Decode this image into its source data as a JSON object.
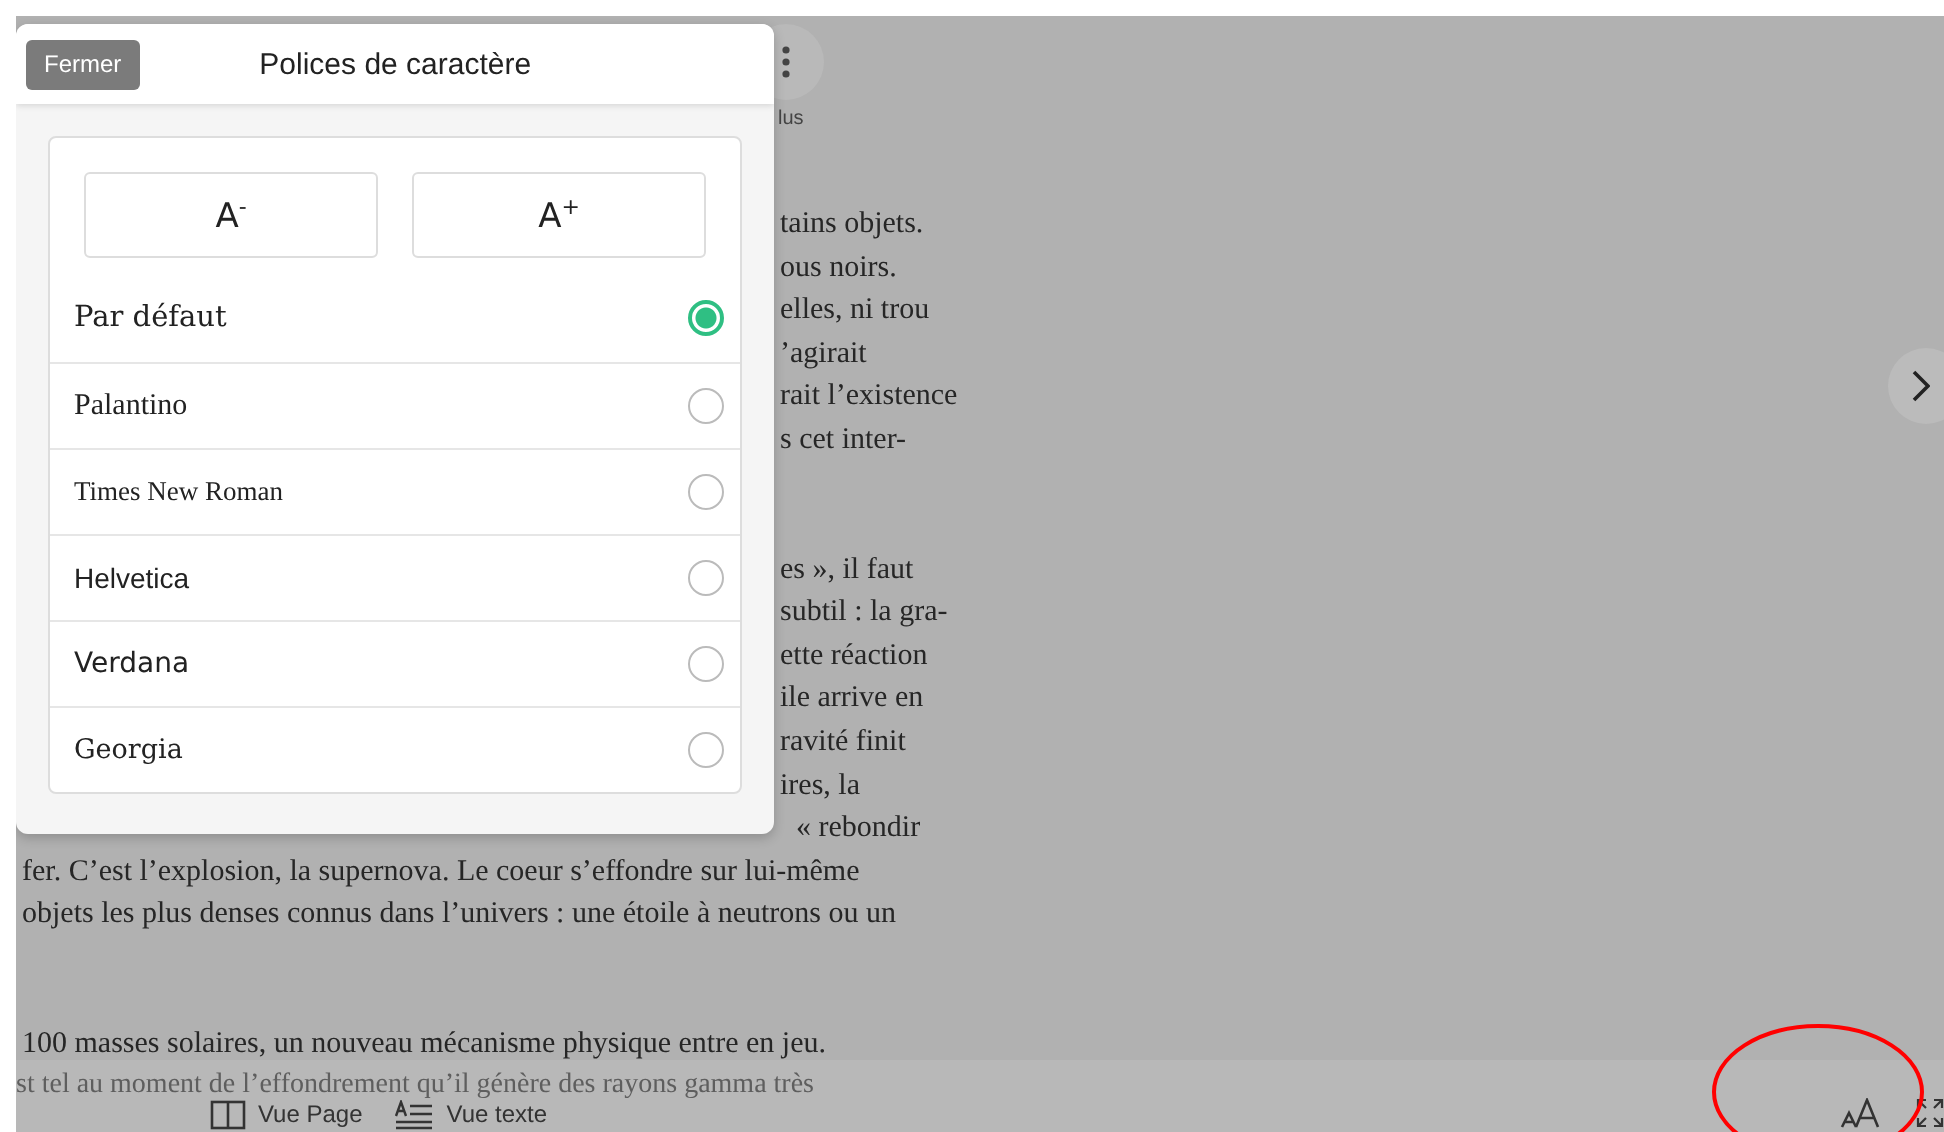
{
  "top_bar": {
    "more_label": "lus"
  },
  "modal": {
    "close": "Fermer",
    "title": "Polices de caractère",
    "size_buttons": [
      "A$^{-}$",
      "A$^{+}$"
    ],
    "fonts": [
      {
        "label": "Par défaut",
        "kind": "default",
        "selected": true
      },
      {
        "label": "Palantino",
        "kind": "palatino",
        "selected": false
      },
      {
        "label": "Times New Roman",
        "kind": "times",
        "selected": false
      },
      {
        "label": "Helvetica",
        "kind": "helvetica",
        "selected": false
      },
      {
        "label": "Verdana",
        "kind": "verdana",
        "selected": false
      },
      {
        "label": "Georgia",
        "kind": "georgia",
        "selected": false
      }
    ]
  },
  "reader": {
    "paragraphs": [
      {
        "lines": [
          {
            "text": "tains objets.",
            "kind": "clipped"
          },
          {
            "text": "ous noirs.",
            "kind": "clipped"
          },
          {
            "text": "elles, ni trou",
            "kind": "clipped"
          },
          {
            "text": "’agirait",
            "kind": "clipped"
          },
          {
            "text": "rait l’existence",
            "kind": "clipped"
          },
          {
            "text": "s cet inter-",
            "kind": "clipped"
          }
        ]
      },
      {
        "lines": [
          {
            "text": "es », il faut",
            "kind": "clipped"
          },
          {
            "text": "subtil : la gra-",
            "kind": "clipped"
          },
          {
            "text": "ette réaction",
            "kind": "clipped"
          },
          {
            "text": "ile arrive en",
            "kind": "clipped"
          },
          {
            "text": "ravité finit",
            "kind": "clipped"
          },
          {
            "text": "ires, la",
            "kind": "clipped"
          },
          {
            "text": "« rebondir",
            "kind": "tail"
          },
          {
            "text": "fer. C’est l’explosion, la supernova. Le coeur s’effondre sur lui-même",
            "kind": "full"
          },
          {
            "text": "objets les plus denses connus dans l’univers : une étoile à neutrons ou un",
            "kind": "full"
          }
        ]
      },
      {
        "lines": [
          {
            "text": "100 masses solaires, un nouveau mécanisme physique entre en jeu.",
            "kind": "full"
          },
          {
            "text": "st tel au moment de l’effondrement qu’il génère des rayons gamma très",
            "kind": "faded"
          }
        ]
      }
    ]
  },
  "bottom_bar": {
    "views": [
      {
        "label": "Vue Page",
        "kind": "page"
      },
      {
        "label": "Vue texte",
        "kind": "text"
      }
    ]
  }
}
